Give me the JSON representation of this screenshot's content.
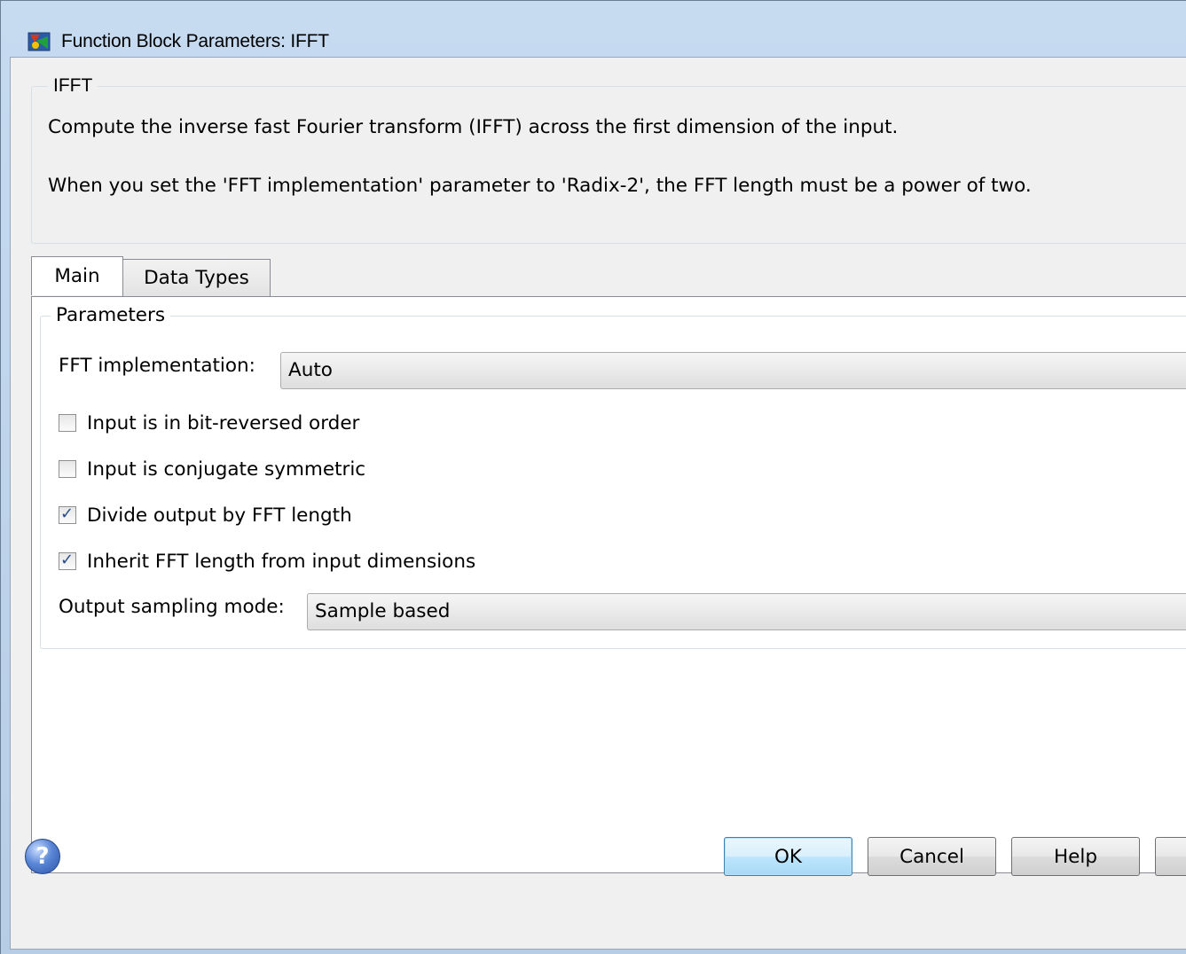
{
  "window": {
    "title": "Function Block Parameters: IFFT"
  },
  "description": {
    "group_label": "IFFT",
    "line1": "Compute the inverse fast Fourier transform (IFFT) across the first dimension of the input.",
    "line2": "When you set the 'FFT implementation' parameter to 'Radix-2', the FFT length must be a power of two."
  },
  "tabs": [
    {
      "label": "Main",
      "active": true
    },
    {
      "label": "Data Types",
      "active": false
    }
  ],
  "parameters": {
    "group_label": "Parameters",
    "fft_implementation": {
      "label": "FFT implementation:",
      "value": "Auto"
    },
    "checkboxes": [
      {
        "label": "Input is in bit-reversed order",
        "checked": false
      },
      {
        "label": "Input is conjugate symmetric",
        "checked": false
      },
      {
        "label": "Divide output by FFT length",
        "checked": true
      },
      {
        "label": "Inherit FFT length from input dimensions",
        "checked": true
      }
    ],
    "output_sampling_mode": {
      "label": "Output sampling mode:",
      "value": "Sample based"
    }
  },
  "buttons": {
    "ok": "OK",
    "cancel": "Cancel",
    "help": "Help",
    "help_icon_glyph": "?"
  },
  "colors": {
    "frame": "#b7cde6",
    "default_button": "#bee6fd",
    "check": "#2a4d8a"
  },
  "icons": [
    "simulink-block-icon",
    "help-question-icon",
    "checkmark-icon"
  ]
}
